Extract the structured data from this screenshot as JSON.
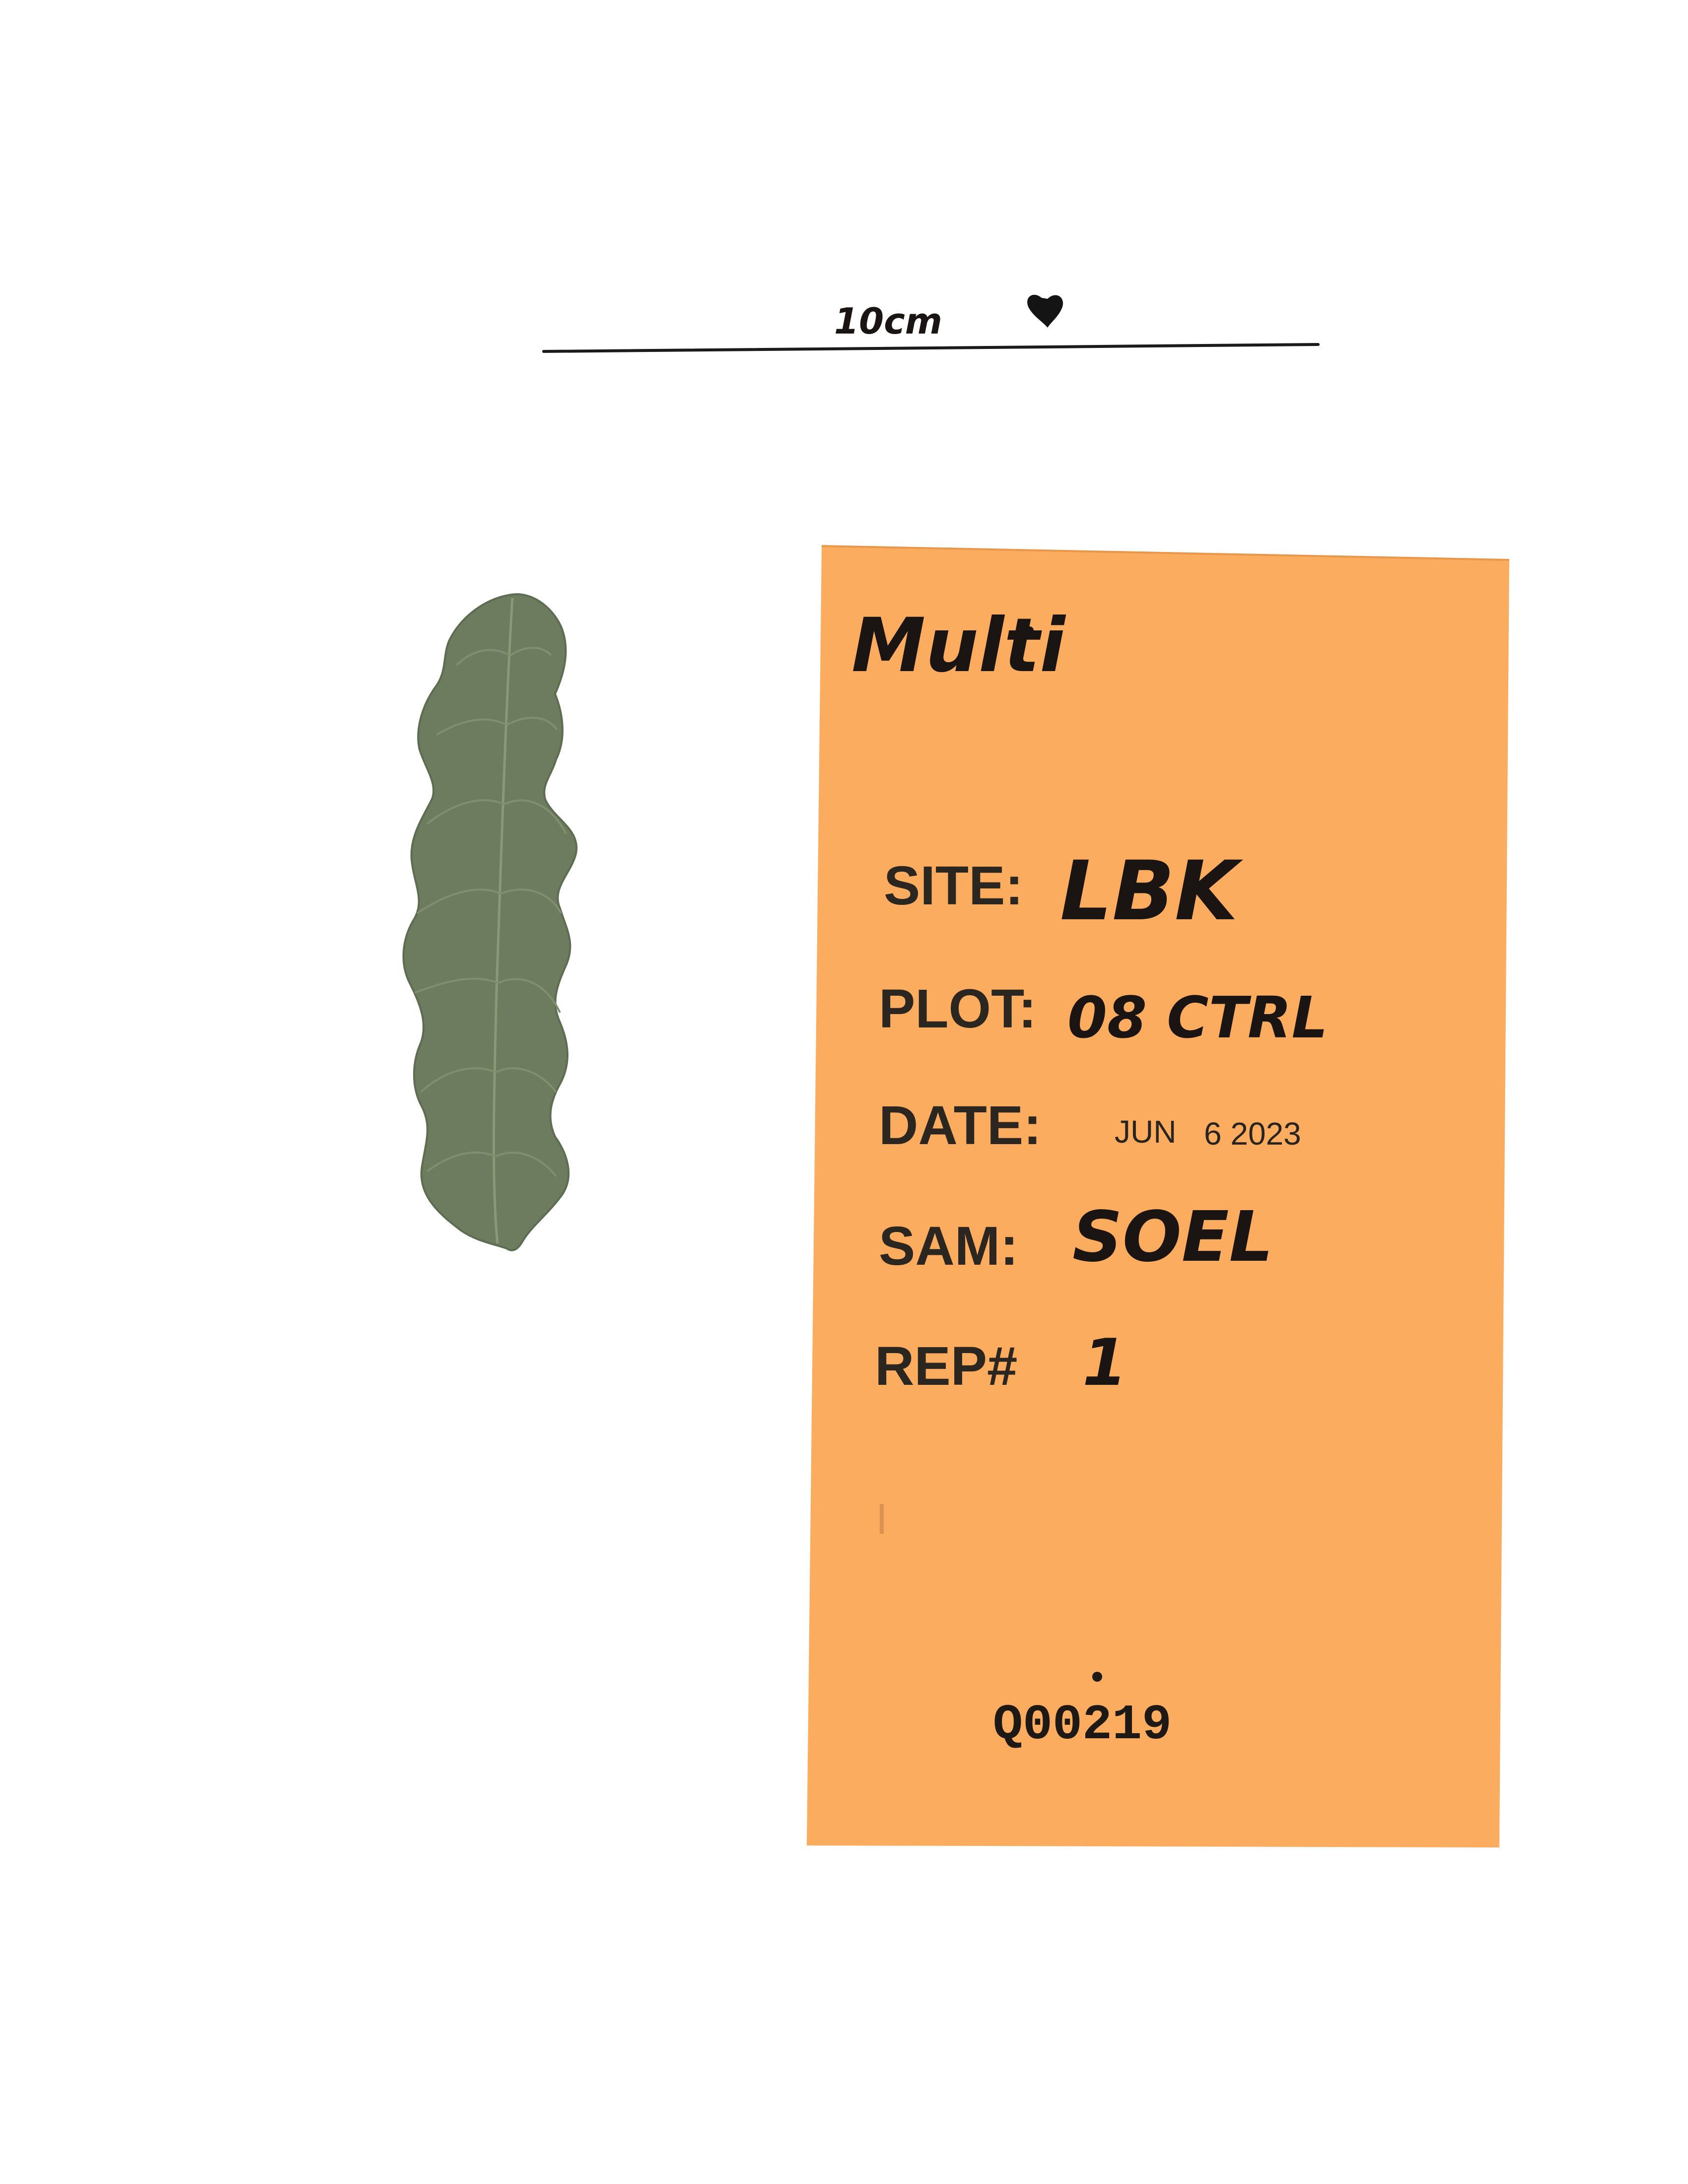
{
  "scale_bar": {
    "label": "10cm"
  },
  "envelope": {
    "header_note": "Multi",
    "fields": [
      {
        "label": "SITE:",
        "value": "LBK"
      },
      {
        "label": "PLOT:",
        "value": "08 CTRL"
      },
      {
        "label": "DATE:",
        "value_month": "JUN",
        "value_day_year": "6 2023"
      },
      {
        "label": "SAM:",
        "value": "SOEL"
      },
      {
        "label": "REP#",
        "value": "1"
      }
    ],
    "sample_id": "Q00219"
  },
  "colors": {
    "background": "#ffffff",
    "envelope": "#fcac5e",
    "leaf": "#6d7c5f",
    "leaf_vein": "#8a9878",
    "ink": "#1a1512"
  },
  "icons": {
    "heart_mark": "heart-icon",
    "leaf_specimen": "leaf-icon"
  }
}
